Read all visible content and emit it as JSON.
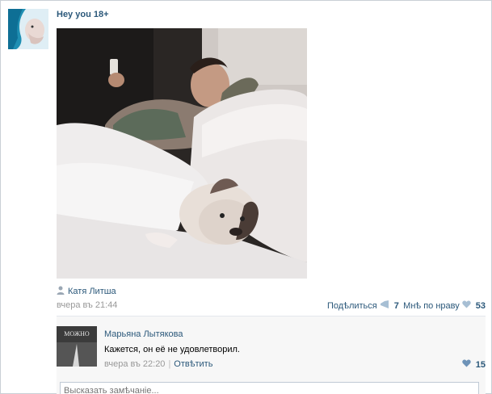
{
  "post": {
    "group_name": "Hey you 18+",
    "author_name": "Катя Литша",
    "date": "вчера въ 21:44",
    "share_label": "Подѣлиться",
    "share_count": "7",
    "like_label": "Мнѣ по нраву",
    "like_count": "53"
  },
  "comment": {
    "avatar_caption": "МОЖНО",
    "author": "Марьяна Лытякова",
    "text": "Кажется, он её не удовлетворил.",
    "date": "вчера въ 22:20",
    "separator": "|",
    "reply_label": "Отвѣтить",
    "like_count": "15"
  },
  "reply_input": {
    "placeholder": "Высказать замѣчаніе..."
  },
  "colors": {
    "link": "#2b587a",
    "muted": "#999999",
    "heart": "#a7bfd4",
    "comment_bg": "#f7f7f7"
  },
  "icons": {
    "author": "person-icon",
    "share": "megaphone-icon",
    "like": "heart-icon"
  }
}
